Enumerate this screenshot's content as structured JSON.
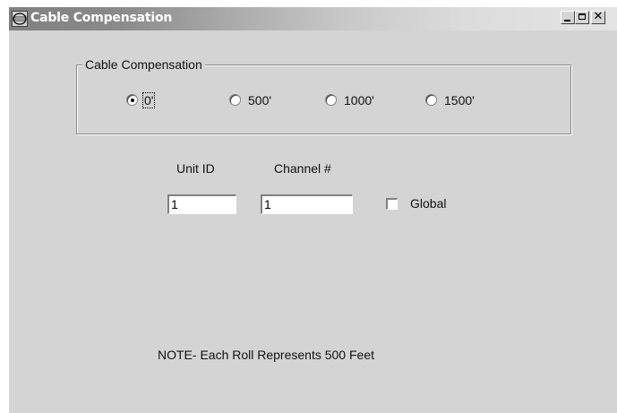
{
  "window": {
    "title": "Cable Compensation",
    "app_icon": "app-logo-icon",
    "controls": {
      "minimize": "minimize-icon",
      "maximize": "maximize-icon",
      "close": "close-icon"
    }
  },
  "cable_compensation": {
    "group_label": "Cable Compensation",
    "selected": "0'",
    "options": [
      {
        "label": "0'",
        "selected": true
      },
      {
        "label": "500'",
        "selected": false
      },
      {
        "label": "1000'",
        "selected": false
      },
      {
        "label": "1500'",
        "selected": false
      }
    ]
  },
  "unit_id": {
    "label": "Unit ID",
    "value": "1"
  },
  "channel": {
    "label": "Channel #",
    "value": "1"
  },
  "global": {
    "label": "Global",
    "checked": false
  },
  "note": "NOTE- Each Roll Represents 500 Feet"
}
